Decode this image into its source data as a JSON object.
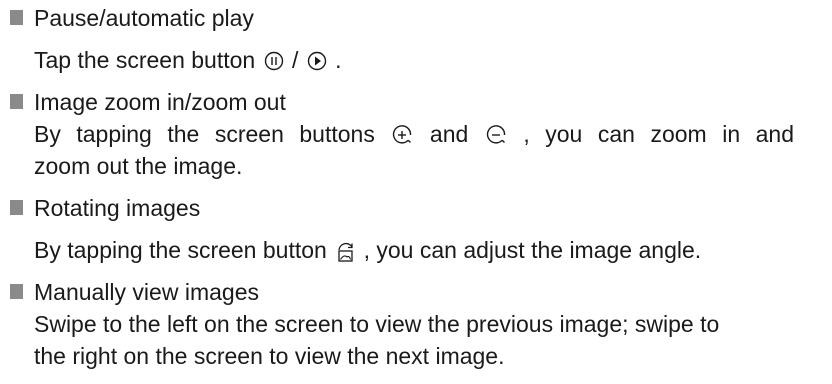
{
  "sections": [
    {
      "heading": "Pause/automatic play",
      "lines": [
        {
          "before": "Tap the screen button ",
          "icon1": "pause-circle-icon",
          "middle": " / ",
          "icon2": "play-circle-icon",
          "after": " ."
        }
      ]
    },
    {
      "heading": "Image zoom in/zoom out",
      "lines": [
        {
          "before": "By tapping the screen  buttons ",
          "icon1": "zoom-in-icon",
          "middle": " and ",
          "icon2": "zoom-out-icon",
          "after": " , you can zoom in   and"
        },
        {
          "text": "zoom out the image."
        }
      ]
    },
    {
      "heading": "Rotating images",
      "lines": [
        {
          "before": "By tapping the screen button ",
          "icon1": "rotate-image-icon",
          "after": " , you can adjust the image angle."
        }
      ]
    },
    {
      "heading": "Manually view images",
      "lines": [
        {
          "text": "Swipe to the left on the screen to view the previous image; swipe to"
        },
        {
          "text": "the right on the screen to view the next image."
        }
      ]
    }
  ]
}
